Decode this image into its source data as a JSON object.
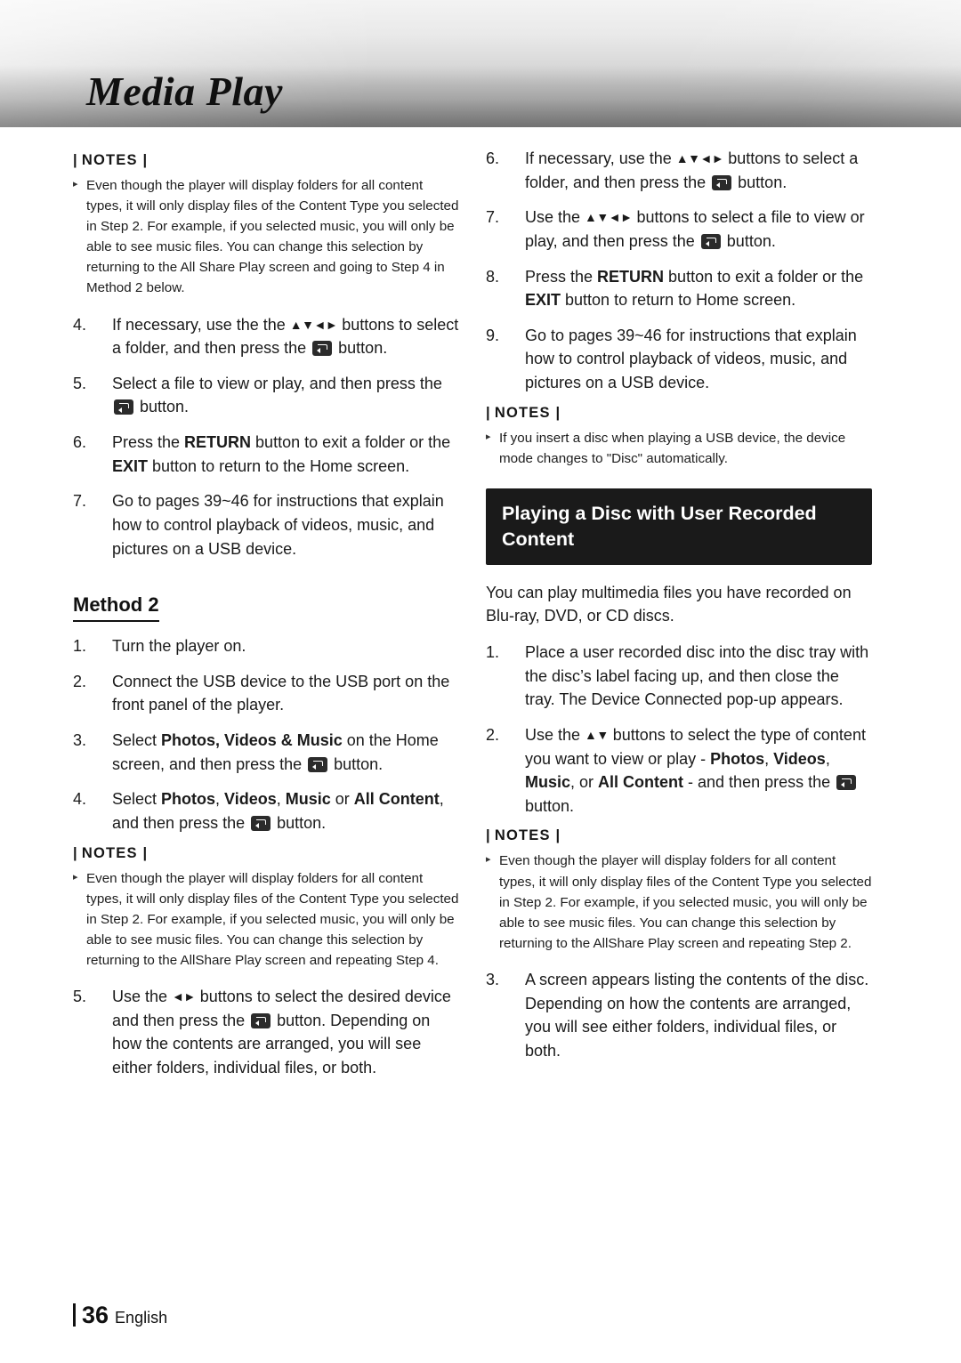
{
  "header": {
    "chapter_title": "Media Play"
  },
  "footer": {
    "page_number": "36",
    "language": "English"
  },
  "left_column": {
    "notes_1": {
      "heading": "NOTES",
      "items": [
        "Even though the player will display folders for all content types, it will only display files of the Content Type you selected in Step 2. For example, if you selected music, you will only be able to see music files. You can change this selection by returning to the All Share Play screen and going to Step 4 in Method 2 below."
      ]
    },
    "steps_1": [
      {
        "num": "4.",
        "text_a": "If necessary, use the the ",
        "arrows": "▲▼◄►",
        "text_b": " buttons to select a folder, and then press the ",
        "button_icon": "enter-button-icon",
        "text_c": " button."
      },
      {
        "num": "5.",
        "text_a": "Select a file to view or play, and then press the ",
        "button_icon": "enter-button-icon",
        "text_b": " button."
      },
      {
        "num": "6.",
        "text_a": "Press the ",
        "bold_a": "RETURN",
        "text_b": " button to exit a folder or the ",
        "bold_b": "EXIT",
        "text_c": " button to return to the Home screen."
      },
      {
        "num": "7.",
        "text_a": "Go to pages 39~46 for instructions that explain how to control playback of videos, music, and pictures on a USB device."
      }
    ],
    "subhead": "Method 2",
    "steps_2": [
      {
        "num": "1.",
        "text_a": "Turn the player on."
      },
      {
        "num": "2.",
        "text_a": "Connect the USB device to the USB port on the front panel of the player."
      },
      {
        "num": "3.",
        "text_a": "Select ",
        "bold_a": "Photos, Videos & Music",
        "text_b": " on the Home screen, and then press the ",
        "button_icon": "enter-button-icon",
        "text_c": " button."
      },
      {
        "num": "4.",
        "text_a": "Select ",
        "bold_a": "Photos",
        "text_b": ", ",
        "bold_b": "Videos",
        "text_c": ", ",
        "bold_c": "Music",
        "text_d": " or ",
        "bold_d": "All Content",
        "text_e": ", and then press the ",
        "button_icon": "enter-button-icon",
        "text_f": " button."
      }
    ],
    "notes_2": {
      "heading": "NOTES",
      "items": [
        "Even though the player will display folders for all content types, it will only display files of the Content Type you selected in Step 2. For example, if you selected music, you will only be able to see music files. You can change this selection by returning to the AllShare Play screen and repeating Step 4."
      ]
    },
    "steps_3": [
      {
        "num": "5.",
        "text_a": "Use the ",
        "arrows": "◄►",
        "text_b": " buttons to select the desired device and then press the ",
        "button_icon": "enter-button-icon",
        "text_c": " button. Depending on how the contents are arranged, you will see either folders, individual files, or both."
      }
    ]
  },
  "right_column": {
    "steps_1": [
      {
        "num": "6.",
        "text_a": "If necessary, use the ",
        "arrows": "▲▼◄►",
        "text_b": " buttons to select a folder, and then press the ",
        "button_icon": "enter-button-icon",
        "text_c": " button."
      },
      {
        "num": "7.",
        "text_a": "Use the ",
        "arrows": "▲▼◄►",
        "text_b": " buttons to select a file to view or play, and then press the ",
        "button_icon": "enter-button-icon",
        "text_c": " button."
      },
      {
        "num": "8.",
        "text_a": "Press the ",
        "bold_a": "RETURN",
        "text_b": " button to exit a folder or the ",
        "bold_b": "EXIT",
        "text_c": " button to return to Home screen."
      },
      {
        "num": "9.",
        "text_a": "Go to pages 39~46 for instructions that explain how to control playback of videos, music, and pictures on a USB device."
      }
    ],
    "notes_1": {
      "heading": "NOTES",
      "items": [
        "If you insert a disc when playing a USB device, the device mode changes to \"Disc\" automatically."
      ]
    },
    "section_banner": "Playing a Disc with User Recorded Content",
    "intro": "You can play multimedia files you have recorded on Blu-ray, DVD, or CD discs.",
    "steps_2": [
      {
        "num": "1.",
        "text_a": "Place a user recorded disc into the disc tray with the disc’s label facing up, and then close the tray. The Device Connected pop-up appears."
      },
      {
        "num": "2.",
        "text_a": "Use the ",
        "arrows": "▲▼",
        "text_b": " buttons to select the type of content you want to view or play - ",
        "bold_a": "Photos",
        "text_c": ", ",
        "bold_b": "Videos",
        "text_d": ", ",
        "bold_c": "Music",
        "text_e": ", or ",
        "bold_d": "All Content",
        "text_f": " - and then press the ",
        "button_icon": "enter-button-icon",
        "text_g": " button."
      }
    ],
    "notes_2": {
      "heading": "NOTES",
      "items": [
        "Even though the player will display folders for all content types, it will only display files of the Content Type you selected in Step 2. For example, if you selected music, you will only be able to see music files. You can change this selection by returning to the AllShare Play screen and repeating Step 2."
      ]
    },
    "steps_3": [
      {
        "num": "3.",
        "text_a": "A screen appears listing the contents of the disc. Depending on how the contents are arranged, you will see either folders, individual files, or both."
      }
    ]
  }
}
